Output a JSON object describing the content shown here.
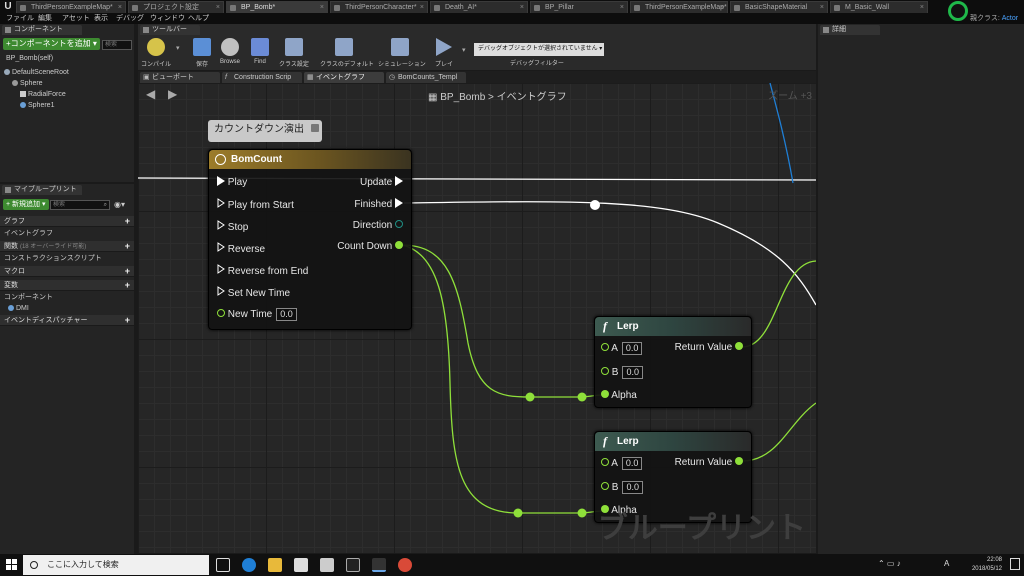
{
  "titlebar": {
    "tabs": [
      {
        "label": "ThirdPersonExampleMap*"
      },
      {
        "label": "プロジェクト設定"
      },
      {
        "label": "BP_Bomb*"
      },
      {
        "label": "ThirdPersonCharacter*"
      },
      {
        "label": "Death_AI*"
      },
      {
        "label": "BP_Pillar"
      },
      {
        "label": "ThirdPersonExampleMap*"
      },
      {
        "label": "BasicShapeMaterial"
      },
      {
        "label": "M_Basic_Wall"
      }
    ],
    "parent_class_label": "親クラス:",
    "parent_class_value": "Actor"
  },
  "menubar": {
    "items": [
      "ファイル",
      "編集",
      "アセット",
      "表示",
      "デバッグ",
      "ウィンドウ",
      "ヘルプ"
    ]
  },
  "components_panel": {
    "tab_label": "コンポーネント",
    "add_button_label": "+コンポーネントを追加 ▾",
    "search_placeholder": "検索",
    "self_label": "BP_Bomb(self)",
    "tree": [
      {
        "label": "DefaultSceneRoot",
        "level": 0
      },
      {
        "label": "Sphere",
        "level": 1
      },
      {
        "label": "RadialForce",
        "level": 2
      },
      {
        "label": "Sphere1",
        "level": 2
      }
    ]
  },
  "myblueprint_panel": {
    "tab_label": "マイブループリント",
    "add_new_label": "+ 新規追加 ▾",
    "search_placeholder": "検索",
    "sections": [
      {
        "label": "グラフ",
        "sub": [
          "イベントグラフ"
        ]
      },
      {
        "label": "関数",
        "note": "(18 オーバーライド可能)",
        "sub": [
          "コンストラクションスクリプト"
        ]
      },
      {
        "label": "マクロ",
        "sub": []
      },
      {
        "label": "変数",
        "sub": []
      },
      {
        "label": "コンポーネント",
        "sub": [
          "DMI"
        ]
      },
      {
        "label": "イベントディスパッチャー",
        "sub": []
      }
    ]
  },
  "toolbar": {
    "tab_label": "ツールバー",
    "buttons": [
      {
        "label": "コンパイル",
        "icon": "compile-icon",
        "color": "#d6c34a"
      },
      {
        "label": "保存",
        "icon": "save-icon",
        "color": "#5b8fd6"
      },
      {
        "label": "Browse",
        "icon": "browse-icon",
        "color": "#c0c0c0"
      },
      {
        "label": "Find",
        "icon": "find-icon",
        "color": "#6b8bd6"
      },
      {
        "label": "クラス設定",
        "icon": "class-settings-icon",
        "color": "#8fa5c8"
      },
      {
        "label": "クラスのデフォルト",
        "icon": "class-defaults-icon",
        "color": "#8fa5c8"
      },
      {
        "label": "シミュレーション",
        "icon": "simulation-icon",
        "color": "#8fa5c8"
      },
      {
        "label": "プレイ",
        "icon": "play-icon",
        "color": "#8fa5c8"
      }
    ],
    "debug_select_value": "デバッグオブジェクトが選択されていません ▾",
    "debug_filter_label": "デバッグフィルター"
  },
  "editor_tabs": [
    {
      "label": "ビューポート",
      "icon": "viewport-icon"
    },
    {
      "label": "Construction Scrip",
      "icon": "function-icon"
    },
    {
      "label": "イベントグラフ",
      "icon": "graph-icon"
    },
    {
      "label": "BomCounts_Templ",
      "icon": "timeline-icon"
    }
  ],
  "graph": {
    "breadcrumb_root": "BP_Bomb",
    "breadcrumb_sep": ">",
    "breadcrumb_current": "イベントグラフ",
    "zoom_label": "ズーム +3",
    "watermark": "ブループリント",
    "comment_label": "カウントダウン演出",
    "timeline_node": {
      "title": "BomCount",
      "inputs": [
        {
          "label": "Play",
          "kind": "exec"
        },
        {
          "label": "Play from Start",
          "kind": "exec"
        },
        {
          "label": "Stop",
          "kind": "exec"
        },
        {
          "label": "Reverse",
          "kind": "exec"
        },
        {
          "label": "Reverse from End",
          "kind": "exec"
        },
        {
          "label": "Set New Time",
          "kind": "exec"
        },
        {
          "label": "New Time",
          "kind": "float",
          "value": "0.0"
        }
      ],
      "outputs": [
        {
          "label": "Update",
          "kind": "exec"
        },
        {
          "label": "Finished",
          "kind": "exec"
        },
        {
          "label": "Direction",
          "kind": "enum"
        },
        {
          "label": "Count Down",
          "kind": "float"
        }
      ]
    },
    "lerp_nodes": [
      {
        "title": "Lerp",
        "a_label": "A",
        "a_value": "0.0",
        "b_label": "B",
        "b_value": "0.0",
        "alpha_label": "Alpha",
        "output_label": "Return Value"
      },
      {
        "title": "Lerp",
        "a_label": "A",
        "a_value": "0.0",
        "b_label": "B",
        "b_value": "0.0",
        "alpha_label": "Alpha",
        "output_label": "Return Value"
      }
    ]
  },
  "details_panel": {
    "tab_label": "詳細"
  },
  "taskbar": {
    "search_placeholder": "ここに入力して検索",
    "time": "22:08",
    "date": "2018/05/12",
    "lang": "A"
  },
  "colors": {
    "exec_wire": "#ffffff",
    "float_pin": "#8fe03a",
    "enum_pin": "#1f8f84",
    "blue_wire": "#1f7fd6",
    "timeline_header": "#9c7c2a",
    "function_header": "#3d5a50",
    "add_button": "#3d8a30",
    "accent_actor": "#4aa3ff"
  }
}
